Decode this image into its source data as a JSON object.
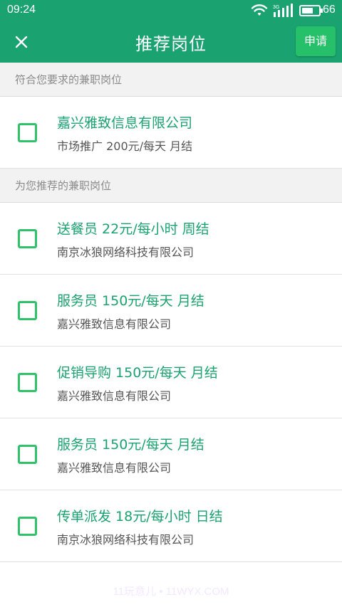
{
  "status_bar": {
    "time": "09:24",
    "battery_level": "66",
    "network_badge": "3G",
    "icons": [
      "wifi-icon",
      "signal-icon",
      "battery-icon"
    ]
  },
  "header": {
    "title": "推荐岗位",
    "apply_label": "申请",
    "close_icon": "close-icon"
  },
  "sections": [
    {
      "header": "符合您要求的兼职岗位",
      "items": [
        {
          "line1": "嘉兴雅致信息有限公司",
          "line2": "市场推广 200元/每天 月结",
          "checked": false
        }
      ]
    },
    {
      "header": "为您推荐的兼职岗位",
      "items": [
        {
          "line1": "送餐员 22元/每小时 周结",
          "line2": "南京冰狼网络科技有限公司",
          "checked": false
        },
        {
          "line1": "服务员 150元/每天 月结",
          "line2": "嘉兴雅致信息有限公司",
          "checked": false
        },
        {
          "line1": "促销导购 150元/每天 月结",
          "line2": "嘉兴雅致信息有限公司",
          "checked": false
        },
        {
          "line1": "服务员 150元/每天 月结",
          "line2": "嘉兴雅致信息有限公司",
          "checked": false
        },
        {
          "line1": "传单派发 18元/每小时 日结",
          "line2": "南京冰狼网络科技有限公司",
          "checked": false
        }
      ]
    }
  ],
  "watermark": "11玩意儿 • 11WYX.COM",
  "colors": {
    "primary": "#1ba271",
    "apply_button": "#26c06a",
    "checkbox": "#2ec36b",
    "section_bg": "#f2f2f2",
    "secondary_text": "#555555"
  }
}
